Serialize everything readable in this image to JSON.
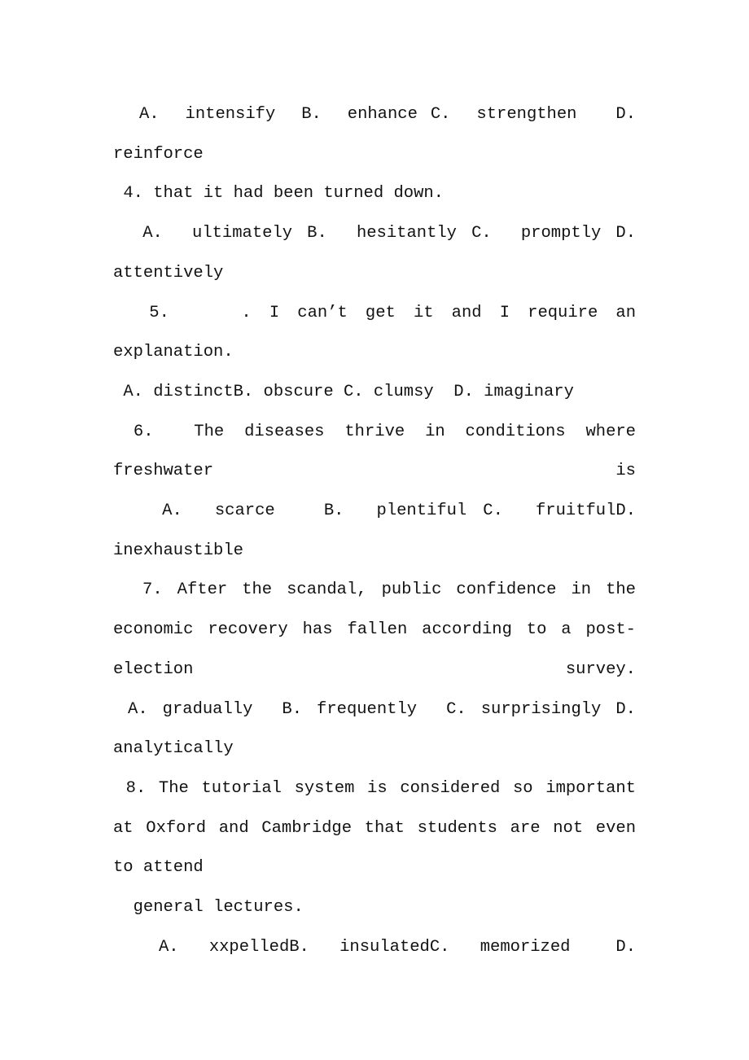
{
  "document": {
    "page_background": "#ffffff",
    "text_color": "#121212",
    "paragraphs": [
      {
        "id": "q3-options",
        "name": "question-3-options",
        "text": "  A.  intensify  B.  enhance C.  strengthen   D. reinforce",
        "justify_last_line": false
      },
      {
        "id": "q4-stem",
        "name": "question-4-stem",
        "text": " 4. that it had been turned down.",
        "justify_last_line": false
      },
      {
        "id": "q4-options",
        "name": "question-4-options",
        "text": "  A.  ultimately B.  hesitantly C.  promptly D. attentively",
        "justify_last_line": false
      },
      {
        "id": "q5-stem",
        "name": "question-5-stem",
        "text": "  5.    . I can’t get it and I require an explanation.",
        "justify_last_line": false
      },
      {
        "id": "q5-options",
        "name": "question-5-options",
        "text": " A. distinctB. obscure C. clumsy  D. imaginary",
        "justify_last_line": false
      },
      {
        "id": "q6-stem",
        "name": "question-6-stem",
        "text": " 6.  The diseases thrive in conditions where freshwater is",
        "justify_last_line": false
      },
      {
        "id": "q6-options",
        "name": "question-6-options",
        "text": "   A.  scarce   B.  plentiful C.  fruitfulD. inexhaustible",
        "justify_last_line": false
      },
      {
        "id": "q7-stem",
        "name": "question-7-stem",
        "text": "  7. After the scandal, public confidence in the economic recovery has fallen according to a post-election survey.",
        "justify_last_line": false
      },
      {
        "id": "q7-options",
        "name": "question-7-options",
        "text": " A. gradually  B. frequently  C. surprisingly D. analytically",
        "justify_last_line": false
      },
      {
        "id": "q8-stem",
        "name": "question-8-stem",
        "text": " 8. The tutorial system is considered so important at Oxford and Cambridge that students are not even to attend",
        "justify_last_line": false
      },
      {
        "id": "q8-stem-cont",
        "name": "question-8-stem-continuation",
        "text": "  general lectures.",
        "justify_last_line": false
      },
      {
        "id": "q8-options",
        "name": "question-8-options",
        "text": "   A.  xxpelledB.  insulatedC.  memorized   D.",
        "justify_last_line": false
      }
    ]
  }
}
